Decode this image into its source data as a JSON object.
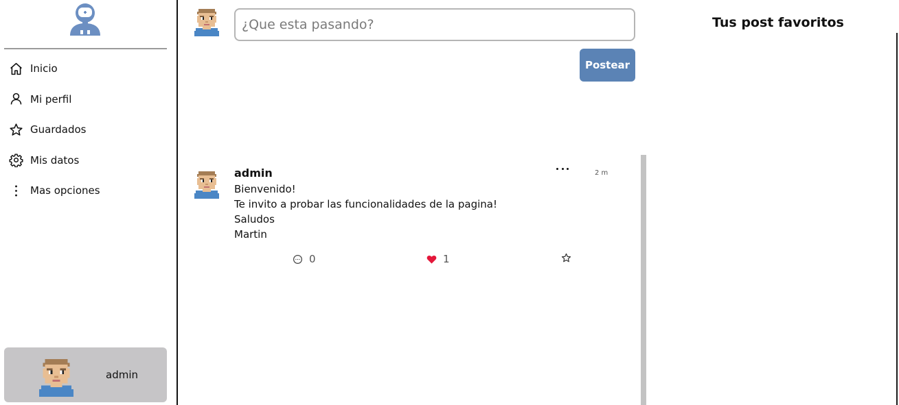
{
  "sidebar": {
    "logo_icon": "astronaut-icon",
    "items": [
      {
        "label": "Inicio",
        "icon": "home-icon"
      },
      {
        "label": "Mi perfil",
        "icon": "user-icon"
      },
      {
        "label": "Guardados",
        "icon": "star-icon"
      },
      {
        "label": "Mis datos",
        "icon": "gear-icon"
      },
      {
        "label": "Mas opciones",
        "icon": "vertical-dots-icon"
      }
    ],
    "user": {
      "name": "admin"
    }
  },
  "composer": {
    "placeholder": "¿Que esta pasando?",
    "value": "",
    "submit_label": "Postear"
  },
  "feed": {
    "posts": [
      {
        "author": "admin",
        "time": "2 m",
        "body": "Bienvenido!\nTe invito a probar las funcionalidades de la pagina!\nSaludos\nMartin",
        "comments": "0",
        "likes": "1",
        "liked": true
      }
    ]
  },
  "favorites": {
    "title": "Tus post favoritos"
  },
  "colors": {
    "accent": "#5b83b5",
    "like": "#e4173a",
    "user_card_bg": "#c6c5c7",
    "scrollbar": "#c3c3c3"
  }
}
